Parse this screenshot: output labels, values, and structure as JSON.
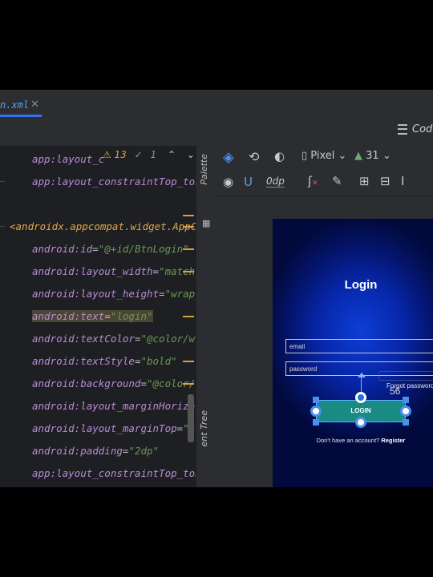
{
  "tab": {
    "label": "n.xml",
    "close": "✕"
  },
  "view": {
    "code_label": "Code"
  },
  "inspection": {
    "warnings": "13",
    "ok": "1",
    "prev": "⌃",
    "next": "⌄"
  },
  "editor": {
    "lines": [
      {
        "attr": "app:layout_c",
        "eq": "",
        "val": ""
      },
      {
        "attr": "app:layout_constraintTop_toBot",
        "eq": "",
        "val": ""
      },
      {
        "tag": "<androidx.appcompat.widget.AppCom"
      },
      {
        "attr": "android:id",
        "eq": "=",
        "val": "\"@+id/BtnLogin\""
      },
      {
        "attr": "android:layout_width",
        "eq": "=",
        "val": "\"match_pa"
      },
      {
        "attr": "android:layout_height",
        "eq": "=",
        "val": "\"wrap_con"
      },
      {
        "attr": "android:text",
        "eq": "=",
        "val": "\"login\""
      },
      {
        "attr": "android:textColor",
        "eq": "=",
        "val": "\"@color/whit"
      },
      {
        "attr": "android:textStyle",
        "eq": "=",
        "val": "\"bold\""
      },
      {
        "attr": "android:background",
        "eq": "=",
        "val": "\"@color/tea"
      },
      {
        "attr": "android:layout_marginHorizont",
        "eq": "",
        "val": ""
      },
      {
        "attr": "android:layout_marginTop",
        "eq": "=",
        "val": "\"56"
      },
      {
        "attr": "android:padding",
        "eq": "=",
        "val": "\"2dp\""
      },
      {
        "attr": "app:layout_constraintTop_toBot",
        "eq": "",
        "val": ""
      }
    ]
  },
  "side": {
    "palette": "Palette",
    "tree": "ent Tree"
  },
  "toolbar": {
    "device": "Pixel",
    "api": "31",
    "margin": "0dp"
  },
  "preview": {
    "title": "Login",
    "email_placeholder": "email",
    "password_placeholder": "password",
    "forgot": "Forgot password",
    "margin_value": "56",
    "button_label": "LOGIN",
    "register_prefix": "Don't have an account?",
    "register_link": "Register"
  },
  "colors": {
    "accent": "#3574f0",
    "button": "#1a8a85",
    "phone_bg": "#0726a8"
  }
}
